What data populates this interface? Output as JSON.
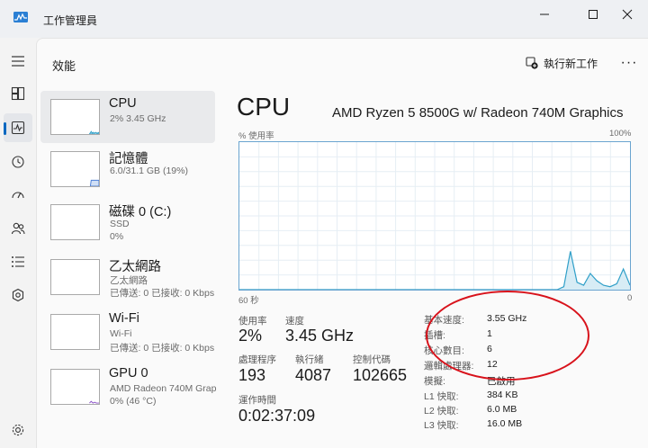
{
  "window": {
    "title": "工作管理員"
  },
  "header": {
    "page_title": "效能",
    "run_task_label": "執行新工作",
    "more_label": "···"
  },
  "nav": {
    "icons": [
      "hamburger-icon",
      "processes-icon",
      "performance-icon",
      "app-history-icon",
      "startup-apps-icon",
      "users-icon",
      "details-icon",
      "services-icon",
      "settings-icon"
    ],
    "active": "performance-icon"
  },
  "resources": [
    {
      "name": "CPU",
      "sub1": "2% 3.45 GHz",
      "sub2": ""
    },
    {
      "name": "記憶體",
      "sub1": "6.0/31.1 GB (19%)",
      "sub2": ""
    },
    {
      "name": "磁碟 0 (C:)",
      "sub1": "SSD",
      "sub2": "0%"
    },
    {
      "name": "乙太網路",
      "sub1": "乙太網路",
      "sub2": "已傳送: 0 已接收: 0 Kbps"
    },
    {
      "name": "Wi-Fi",
      "sub1": "Wi-Fi",
      "sub2": "已傳送: 0 已接收: 0 Kbps"
    },
    {
      "name": "GPU 0",
      "sub1": "AMD Radeon 740M Graphics",
      "sub2": "0% (46 °C)"
    }
  ],
  "detail": {
    "heading": "CPU",
    "model": "AMD Ryzen 5 8500G w/ Radeon 740M Graphics",
    "graph": {
      "y_label": "% 使用率",
      "y_max_label": "100%",
      "x_left_label": "60 秒",
      "x_right_label": "0",
      "usage_recent": [
        0,
        0,
        0,
        0,
        0,
        0,
        0,
        0,
        0,
        0,
        0,
        0,
        0,
        0,
        0,
        0,
        0,
        0,
        0,
        0,
        0,
        0,
        0,
        0,
        0,
        0,
        0,
        0,
        0,
        0,
        0,
        0,
        0,
        0,
        0,
        0,
        0,
        0,
        0,
        0,
        0,
        0,
        0,
        0,
        0,
        0,
        0,
        0,
        0,
        2,
        26,
        5,
        3,
        11,
        6,
        3,
        2,
        4,
        14,
        3
      ]
    },
    "stats": {
      "utilization_label": "使用率",
      "utilization": "2%",
      "speed_label": "速度",
      "speed": "3.45 GHz",
      "processes_label": "處理程序",
      "processes": "193",
      "threads_label": "執行緒",
      "threads": "4087",
      "handles_label": "控制代碼",
      "handles": "102665",
      "uptime_label": "運作時間",
      "uptime": "0:02:37:09"
    },
    "specs": [
      {
        "label": "基本速度:",
        "value": "3.55 GHz"
      },
      {
        "label": "插槽:",
        "value": "1"
      },
      {
        "label": "核心數目:",
        "value": "6"
      },
      {
        "label": "邏輯處理器:",
        "value": "12"
      },
      {
        "label": "模擬:",
        "value": "已啟用"
      },
      {
        "label": "L1 快取:",
        "value": "384 KB"
      },
      {
        "label": "L2 快取:",
        "value": "6.0 MB"
      },
      {
        "label": "L3 快取:",
        "value": "16.0 MB"
      }
    ]
  },
  "colors": {
    "accent": "#0067c0",
    "graph_line": "#2f9fc8",
    "graph_fill": "#d7ecf5",
    "grid": "#e6eef4",
    "annotation": "#d8121b",
    "memory_fill": "#d0dff5",
    "gpu_line": "#8a4fc7"
  }
}
